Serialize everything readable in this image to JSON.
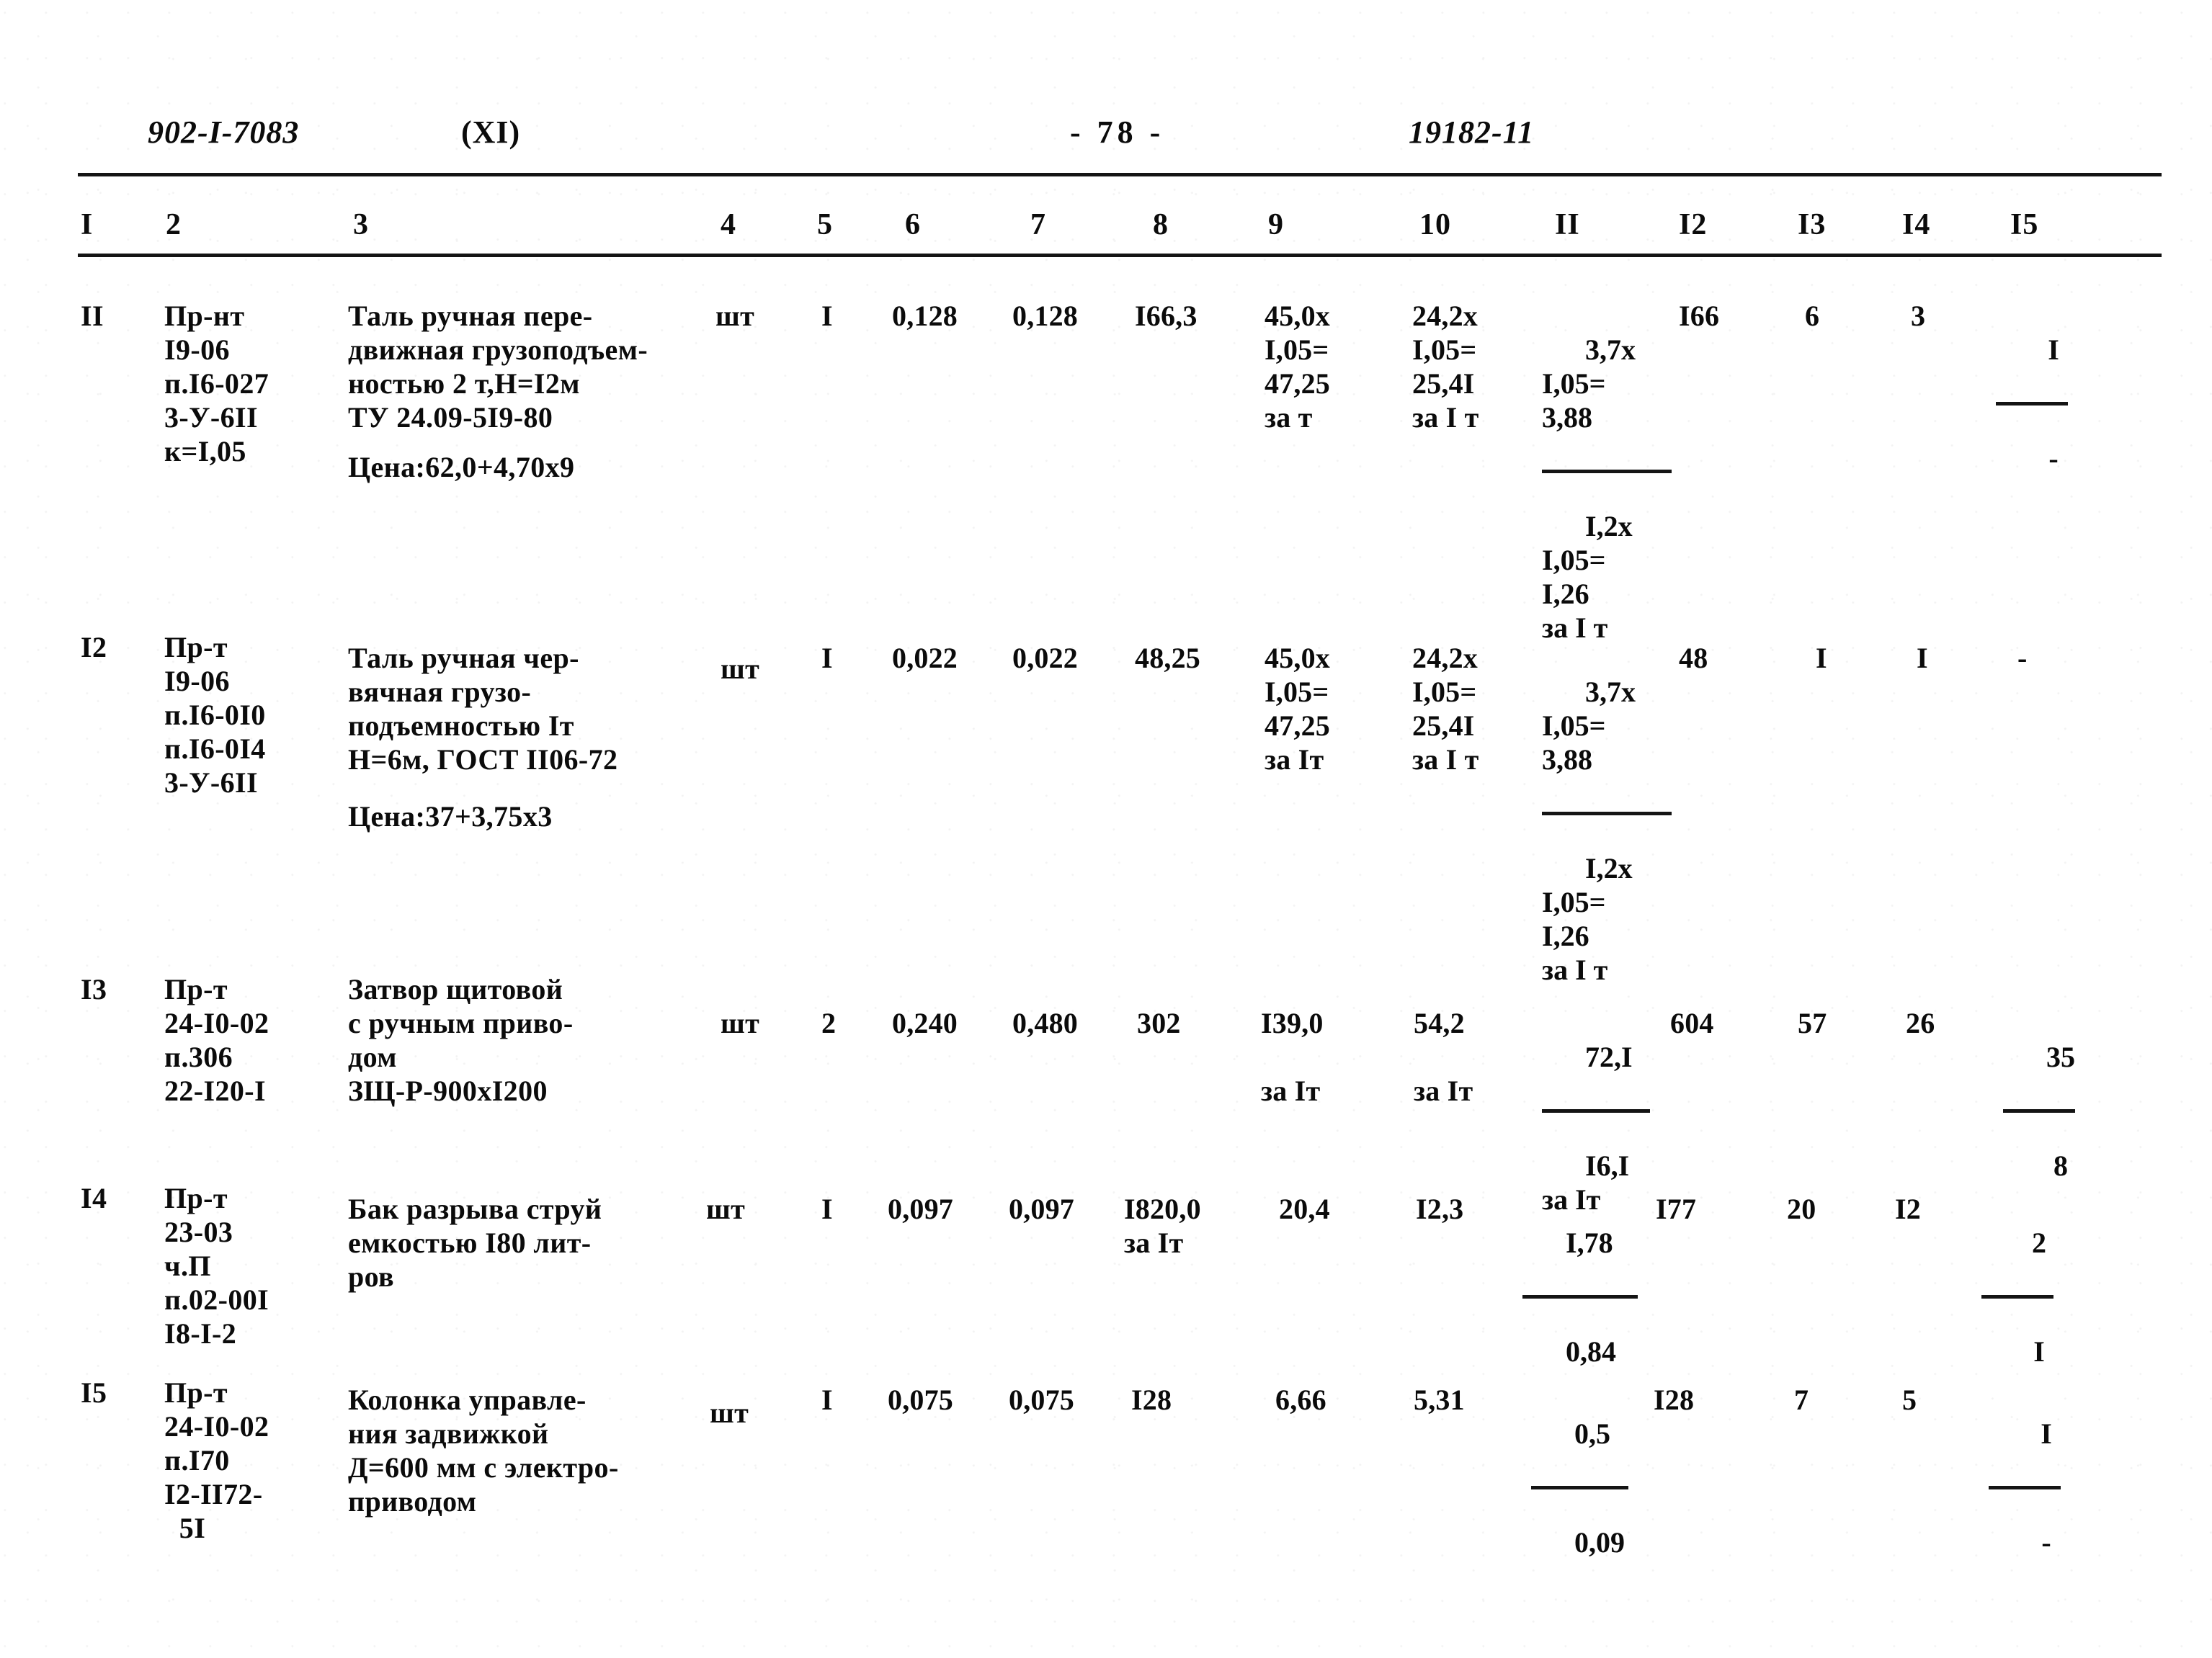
{
  "header": {
    "document_code": "902-I-7083",
    "part": "(XI)",
    "page_number": "- 78 -",
    "sheet_code": "19182-11"
  },
  "table": {
    "column_numbers": [
      "I",
      "2",
      "3",
      "4",
      "5",
      "6",
      "7",
      "8",
      "9",
      "10",
      "II",
      "I2",
      "I3",
      "I4",
      "I5"
    ],
    "rows": [
      {
        "col1": "II",
        "col2": "Пр-нт\nI9-06\nп.I6-027\n3-У-6II\nк=I,05",
        "col3_lines": "Таль ручная пере-\nдвижная грузоподъем-\nностью 2 т,Н=I2м\nТУ 24.09-5I9-80",
        "col3_price": "Цена:62,0+4,70х9",
        "col4": "шт",
        "col5": "I",
        "col6": "0,128",
        "col7": "0,128",
        "col8": "I66,3",
        "col9": "45,0х\nI,05=\n47,25\nза т",
        "col10": "24,2х\nI,05=\n25,4I\nза I т",
        "col11_top": "3,7х\nI,05=\n3,88",
        "col11_bottom": "I,2х\nI,05=\nI,26\nза I т",
        "col12": "I66",
        "col13": "6",
        "col14": "3",
        "col15_top": "I",
        "col15_bottom": "-"
      },
      {
        "col1": "I2",
        "col2": "Пр-т\nI9-06\nп.I6-0I0\nп.I6-0I4\n3-У-6II",
        "col3_lines": "Таль ручная чер-\nвячная грузо-\nподъемностью Iт\nН=6м, ГОСТ II06-72",
        "col3_price": "Цена:37+3,75х3",
        "col4": "шт",
        "col5": "I",
        "col6": "0,022",
        "col7": "0,022",
        "col8": "48,25",
        "col9": "45,0х\nI,05=\n47,25\nза Iт",
        "col10": "24,2х\nI,05=\n25,4I\nза I т",
        "col11_top": "3,7х\nI,05=\n3,88",
        "col11_bottom": "I,2х\nI,05=\nI,26\nза I т",
        "col12": "48",
        "col13": "I",
        "col14": "I",
        "col15_top": "",
        "col15_bottom": "-"
      },
      {
        "col1": "I3",
        "col2": "Пр-т\n24-I0-02\nп.306\n22-I20-I",
        "col3_lines": "Затвор щитовой\nс ручным приво-\nдом\nЗЩ-Р-900хI200",
        "col3_price": "",
        "col4": "шт",
        "col5": "2",
        "col6": "0,240",
        "col7": "0,480",
        "col8": "302",
        "col9": "I39,0\n\nза Iт",
        "col10": "54,2\n\nза Iт",
        "col11_top": "72,I",
        "col11_bottom": "I6,I\nза Iт",
        "col12": "604",
        "col13": "57",
        "col14": "26",
        "col15_top": "35",
        "col15_bottom": "8"
      },
      {
        "col1": "I4",
        "col2": "Пр-т\n23-03\nч.П\nп.02-00I\nI8-I-2",
        "col3_lines": "Бак разрыва струй\nемкостью I80 лит-\nров",
        "col3_price": "",
        "col4": "шт",
        "col5": "I",
        "col6": "0,097",
        "col7": "0,097",
        "col8": "I820,0\nза Iт",
        "col9": "20,4",
        "col10": "I2,3",
        "col11_top": "I,78",
        "col11_bottom": "0,84",
        "col12": "I77",
        "col13": "20",
        "col14": "I2",
        "col15_top": "2",
        "col15_bottom": "I"
      },
      {
        "col1": "I5",
        "col2": "Пр-т\n24-I0-02\nп.I70\nI2-II72-\n  5I",
        "col3_lines": "Колонка управле-\nния задвижкой\nД=600 мм с электро-\nприводом",
        "col3_price": "",
        "col4": "шт",
        "col5": "I",
        "col6": "0,075",
        "col7": "0,075",
        "col8": "I28",
        "col9": "6,66",
        "col10": "5,31",
        "col11_top": "0,5",
        "col11_bottom": "0,09",
        "col12": "I28",
        "col13": "7",
        "col14": "5",
        "col15_top": "I",
        "col15_bottom": "-"
      }
    ]
  }
}
